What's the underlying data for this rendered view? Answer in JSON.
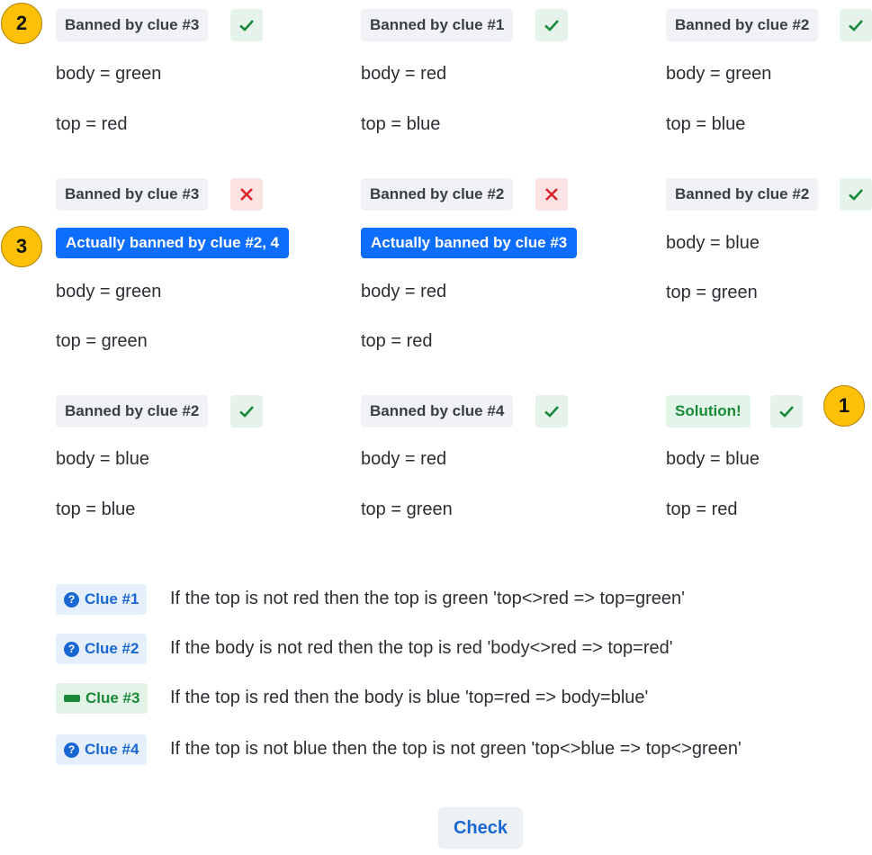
{
  "cards": [
    {
      "tag": "Banned by clue #3",
      "status": "ok",
      "body": "body = green",
      "top": "top = red"
    },
    {
      "tag": "Banned by clue #1",
      "status": "ok",
      "body": "body = red",
      "top": "top = blue"
    },
    {
      "tag": "Banned by clue #2",
      "status": "ok",
      "body": "body = green",
      "top": "top = blue"
    },
    {
      "tag": "Banned by clue #3",
      "status": "bad",
      "actual": "Actually banned by clue #2, 4",
      "body": "body = green",
      "top": "top = green"
    },
    {
      "tag": "Banned by clue #2",
      "status": "bad",
      "actual": "Actually banned by clue #3",
      "body": "body = red",
      "top": "top = red"
    },
    {
      "tag": "Banned by clue #2",
      "status": "ok",
      "body": "body = blue",
      "top": "top = green"
    },
    {
      "tag": "Banned by clue #2",
      "status": "ok",
      "body": "body = blue",
      "top": "top = blue"
    },
    {
      "tag": "Banned by clue #4",
      "status": "ok",
      "body": "body = red",
      "top": "top = green"
    },
    {
      "tag": "Solution!",
      "status": "ok",
      "body": "body = blue",
      "top": "top = red"
    }
  ],
  "callouts": {
    "one": "1",
    "two": "2",
    "three": "3"
  },
  "clues": [
    {
      "label": "Clue #1",
      "icon": "question-icon",
      "text": "If the top is not red then the top is green 'top<>red => top=green'"
    },
    {
      "label": "Clue #2",
      "icon": "question-icon",
      "text": "If the body is not red then the top is red 'body<>red => top=red'"
    },
    {
      "label": "Clue #3",
      "icon": "bar-icon",
      "text": "If the top is red then the body is blue 'top=red => body=blue'"
    },
    {
      "label": "Clue #4",
      "icon": "question-icon",
      "text": "If the top is not blue then the top is not green 'top<>blue => top<>green'"
    }
  ],
  "check_button": "Check",
  "colors": {
    "ok": "#1a8a3a",
    "bad": "#d9262b",
    "primary": "#0d6efd",
    "badge": "#ffc107"
  }
}
